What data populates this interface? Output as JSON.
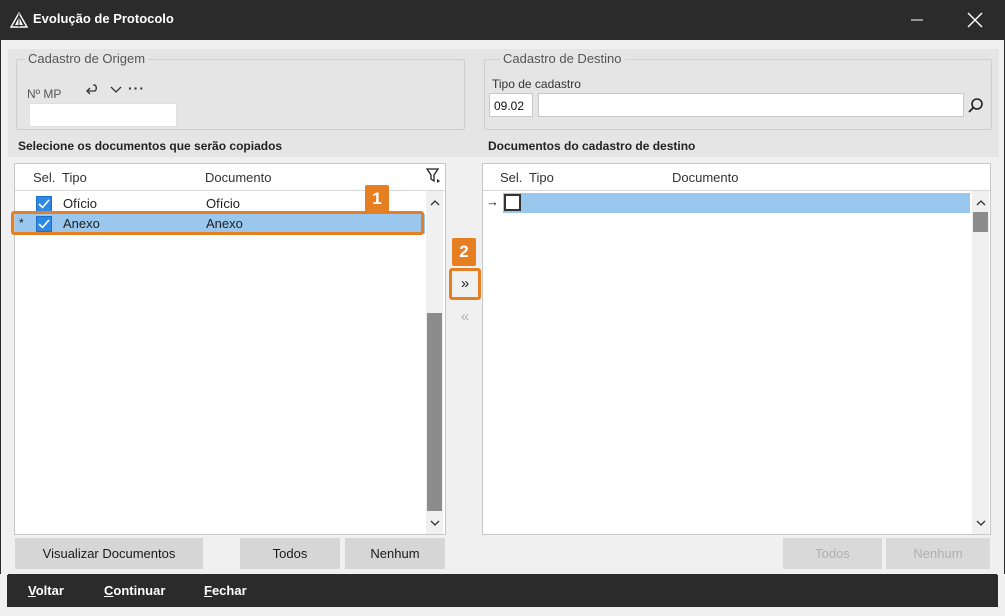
{
  "window": {
    "title": "Evolução de  Protocolo"
  },
  "origem": {
    "legend": "Cadastro de Origem",
    "mp_label": "Nº MP",
    "more_label": "···",
    "mp_value": ""
  },
  "destino": {
    "legend": "Cadastro de Destino",
    "tipo_label": "Tipo de cadastro",
    "tipo_code": "09.02",
    "tipo_desc": ""
  },
  "left_panel": {
    "title": "Selecione os documentos que serão copiados",
    "columns": [
      "Sel.",
      "Tipo",
      "Documento"
    ],
    "rows": [
      {
        "indicator": "",
        "checked": true,
        "tipo": "Ofício",
        "documento": "Ofício"
      },
      {
        "indicator": "*",
        "checked": true,
        "tipo": "Anexo",
        "documento": "Anexo"
      }
    ],
    "buttons": {
      "visualizar": "Visualizar Documentos",
      "todos": "Todos",
      "nenhum": "Nenhum"
    }
  },
  "right_panel": {
    "title": "Documentos do cadastro de destino",
    "columns": [
      "Sel.",
      "Tipo",
      "Documento"
    ],
    "rows": [
      {
        "indicator": "→",
        "checked": false,
        "tipo": "",
        "documento": ""
      }
    ],
    "buttons": {
      "todos": "Todos",
      "nenhum": "Nenhum"
    }
  },
  "transfer": {
    "forward": "»",
    "back": "«"
  },
  "annotations": {
    "badge1": "1",
    "badge2": "2",
    "color": "#e57f21"
  },
  "bottom_bar": {
    "voltar": {
      "underline": "V",
      "rest": "oltar"
    },
    "continuar": {
      "underline": "C",
      "rest": "ontinuar"
    },
    "fechar": {
      "underline": "F",
      "rest": "echar"
    }
  },
  "colors": {
    "titlebar": "#2b2b2b",
    "selected_row": "#9ac7ee",
    "checkbox": "#2e88e6",
    "accent": "#e57f21"
  }
}
